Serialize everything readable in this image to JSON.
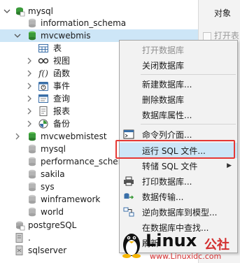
{
  "tree": {
    "mysql": "mysql",
    "information_schema": "information_schema",
    "mvcwebmis": "mvcwebmis",
    "tables": "表",
    "views": "视图",
    "functions": "函数",
    "events": "事件",
    "queries": "查询",
    "reports": "报表",
    "backup": "备份",
    "mvcwebmistest": "mvcwebmistest",
    "db_mysql": "mysql",
    "performance_schema": "performance_schem",
    "sakila": "sakila",
    "sys": "sys",
    "winframework": "winframework",
    "world": "world",
    "postgresql": "postgreSQL",
    "dot": ".",
    "sqlserver": "sqlserver"
  },
  "right_pane": {
    "tab": "对象",
    "open_table": "打开表"
  },
  "context_menu": {
    "open_db": "打开数据库",
    "close_db": "关闭数据库",
    "new_db": "新建数据库...",
    "delete_db": "删除数据库",
    "db_props": "数据库属性...",
    "console": "命令列介面...",
    "run_sql": "运行 SQL 文件...",
    "dump_sql": "转储 SQL 文件",
    "print_db": "打印数据库...",
    "data_transfer": "数据传输...",
    "reverse_model": "逆向数据库到模型...",
    "find_in_db": "在数据库中查找...",
    "refresh": "刷新"
  },
  "watermark": {
    "brand": "Linux",
    "cn": "公社",
    "url": "www.Linuxidc.com"
  },
  "colors": {
    "selection": "#cde6f7",
    "highlight_border": "#e53935",
    "db_green": "#3b9a3b"
  }
}
